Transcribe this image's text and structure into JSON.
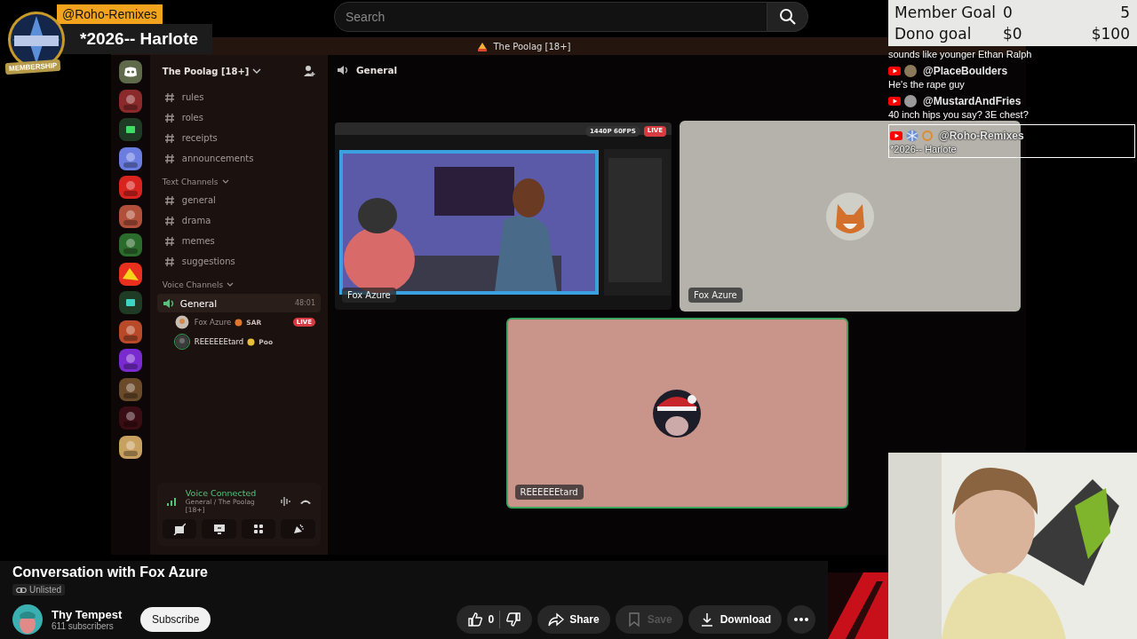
{
  "search": {
    "placeholder": "Search"
  },
  "member_alert": {
    "handle": "@Roho-Remixes",
    "message": "*2026-- Harlote",
    "badge": "MEMBERSHIP"
  },
  "discord": {
    "title": "The Poolag [18+]",
    "server_name": "The Poolag [18+]",
    "channels": [
      {
        "name": "rules",
        "selected": false
      },
      {
        "name": "roles",
        "selected": false
      },
      {
        "name": "receipts",
        "selected": false
      },
      {
        "name": "announcements",
        "selected": false
      }
    ],
    "categories": [
      {
        "name": "Text Channels",
        "expanded": true,
        "channels": [
          {
            "name": "general",
            "selected": false
          },
          {
            "name": "drama",
            "selected": false
          },
          {
            "name": "memes",
            "selected": false
          },
          {
            "name": "suggestions",
            "selected": false
          }
        ]
      },
      {
        "name": "Voice Channels",
        "expanded": true,
        "voice_channels": [
          {
            "name": "General",
            "selected": true,
            "time": "48:01",
            "members": [
              {
                "name": "Fox Azure",
                "tag": "SAR",
                "badge": "LIVE",
                "speaking": false
              },
              {
                "name": "REEEEEEtard",
                "tag": "Poo",
                "speaking": true
              }
            ]
          }
        ]
      }
    ],
    "voice_status": {
      "title": "Voice Connected",
      "location": "General / The Poolag [18+]"
    },
    "header": {
      "channel": "General"
    },
    "tiles": [
      {
        "kind": "stream",
        "name": "Fox Azure",
        "quality": "1440P 60FPS",
        "badge": "LIVE",
        "speaking": false
      },
      {
        "kind": "avatar",
        "name": "Fox Azure",
        "speaking": false
      },
      {
        "kind": "avatar",
        "name": "REEEEEEtard",
        "speaking": true
      }
    ]
  },
  "goals": [
    {
      "label": "Member Goal",
      "current": "0",
      "target": "5"
    },
    {
      "label": "Dono goal",
      "current": "$0",
      "target": "$100"
    }
  ],
  "chat": [
    {
      "text": "sounds like younger Ethan Ralph",
      "highlighted": false
    },
    {
      "author": "@PlaceBoulders",
      "text": "He's the rape guy",
      "highlighted": false
    },
    {
      "author": "@MustardAndFries",
      "text": "40 inch hips you say? 3E chest?",
      "highlighted": false
    },
    {
      "author": "@Roho-Remixes",
      "text": "*2026-- Harlote",
      "member": true,
      "highlighted": true
    }
  ],
  "video": {
    "title": "Conversation with Fox Azure",
    "visibility": "Unlisted",
    "channel": "Thy Tempest",
    "subscribers": "611 subscribers",
    "subscribe": "Subscribe",
    "likes": "0",
    "actions": [
      {
        "kind": "share",
        "label": "Share",
        "disabled": false
      },
      {
        "kind": "save",
        "label": "Save",
        "disabled": true
      },
      {
        "kind": "download",
        "label": "Download",
        "disabled": false
      }
    ]
  }
}
